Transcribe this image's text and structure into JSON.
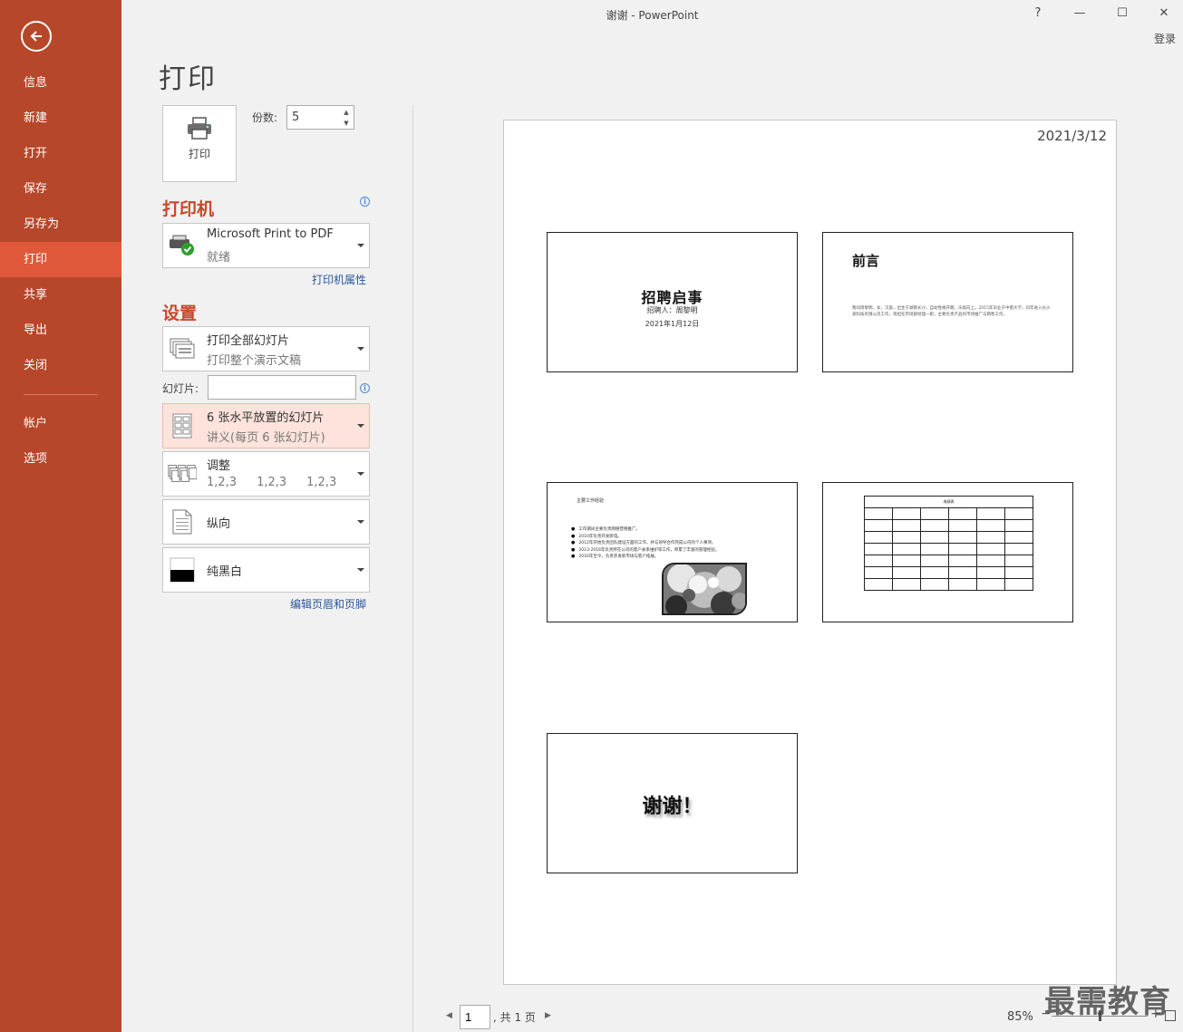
{
  "app": {
    "window_title": "谢谢 - PowerPoint",
    "help": "?",
    "minimize": "—",
    "maximize": "☐",
    "close": "✕",
    "login": "登录"
  },
  "sidebar": {
    "items": [
      {
        "label": "信息"
      },
      {
        "label": "新建"
      },
      {
        "label": "打开"
      },
      {
        "label": "保存"
      },
      {
        "label": "另存为"
      },
      {
        "label": "打印",
        "active": true
      },
      {
        "label": "共享"
      },
      {
        "label": "导出"
      },
      {
        "label": "关闭"
      }
    ],
    "bottom_items": [
      {
        "label": "帐户"
      },
      {
        "label": "选项"
      }
    ],
    "accent": "#b7472a",
    "active_color": "#e0583a"
  },
  "print": {
    "page_title": "打印",
    "print_button": "打印",
    "copies_label": "份数:",
    "copies_value": "5",
    "printer_heading": "打印机",
    "printer_name": "Microsoft Print to PDF",
    "printer_status": "就绪",
    "printer_properties": "打印机属性",
    "settings_heading": "设置",
    "range_title": "打印全部幻灯片",
    "range_sub": "打印整个演示文稿",
    "slides_label": "幻灯片:",
    "slides_value": "",
    "layout_title": "6 张水平放置的幻灯片",
    "layout_sub": "讲义(每页 6 张幻灯片)",
    "collate_title": "调整",
    "collate_nums": [
      "1,2,3",
      "1,2,3",
      "1,2,3"
    ],
    "orientation": "纵向",
    "color_mode": "纯黑白",
    "edit_header_footer": "编辑页眉和页脚"
  },
  "preview": {
    "date": "2021/3/12",
    "slide1": {
      "title": "招聘启事",
      "subtitle": "招聘人：周黎明",
      "date": "2021年1月12日"
    },
    "slide2": {
      "title": "前言",
      "body": "我叫周黎明，女，汉族，出生于湖南长沙，自幼性格开朗，乐观向上。2015年毕业于中南大学，同年进入长沙某科技有限公司工作，现担任市场部经理一职，主要负责产品的市场推广与销售工作。"
    },
    "slide3": {
      "title": "主要工作经验",
      "items": [
        "工作期间主要负责网络营销推广。",
        "2010年负责开发新电。",
        "2012年开始负责团队建设方面的工作，并与领导合作完成公司的个人事项。",
        "2013-2016年负责所在公司的客户关系维护等工作，积累了丰富的管理经验。",
        "2016年至今，负责开发新市场与客户拓展。"
      ]
    },
    "slide4": {
      "table_caption": "成绩表"
    },
    "slide5": {
      "title": "谢谢！"
    }
  },
  "footer": {
    "page_value": "1",
    "page_total": ", 共 1 页",
    "zoom": "85%",
    "zoom_level": 0.5
  },
  "watermark": "最需教育"
}
